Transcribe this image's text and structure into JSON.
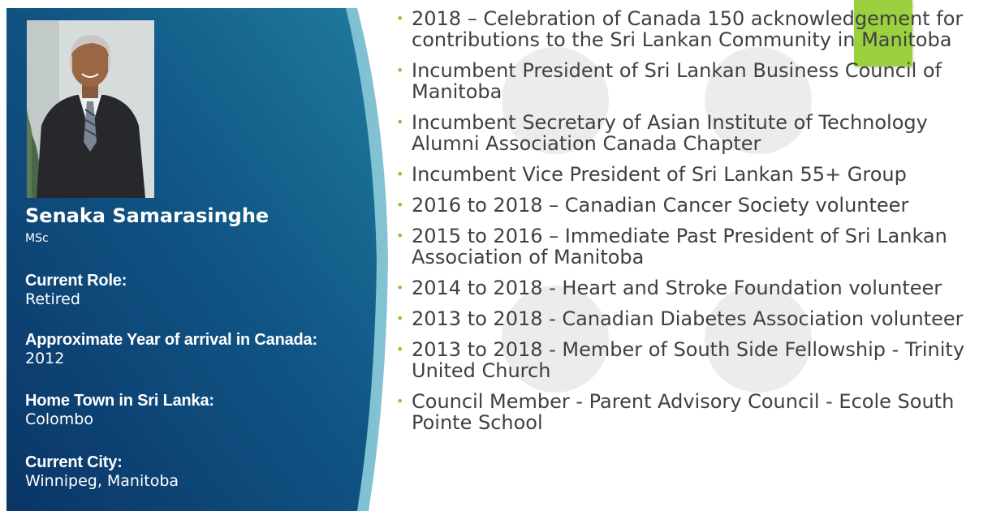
{
  "profile": {
    "name": "Senaka Samarasinghe",
    "degree": "MSc",
    "fields": [
      {
        "label": "Current Role:",
        "value": "Retired"
      },
      {
        "label": "Approximate Year of arrival in Canada:",
        "value": "2012"
      },
      {
        "label": "Home Town in Sri Lanka:",
        "value": "Colombo"
      },
      {
        "label": "Current City:",
        "value": "Winnipeg, Manitoba"
      }
    ]
  },
  "bullets": [
    "2018 – Celebration of Canada 150 acknowledgement for contributions to the Sri Lankan Community in Manitoba",
    "Incumbent President of Sri Lankan Business Council of Manitoba",
    "Incumbent Secretary of Asian Institute of Technology Alumni Association Canada Chapter",
    "Incumbent Vice President of Sri Lankan 55+ Group",
    "2016 to 2018 – Canadian Cancer Society volunteer",
    "2015 to 2016 – Immediate Past President of Sri Lankan Association of Manitoba",
    "2014 to 2018 - Heart and Stroke Foundation volunteer",
    "2013 to 2018 - Canadian Diabetes Association volunteer",
    "2013 to 2018 - Member of South Side Fellowship - Trinity United Church",
    "Council Member - Parent Advisory Council - Ecole South Pointe School"
  ],
  "colors": {
    "panel_dark": "#0b3f73",
    "panel_mid": "#1a6a8e",
    "panel_light": "#2a8aa8",
    "accent_green": "#9bd03f",
    "bullet_text": "#404040"
  }
}
